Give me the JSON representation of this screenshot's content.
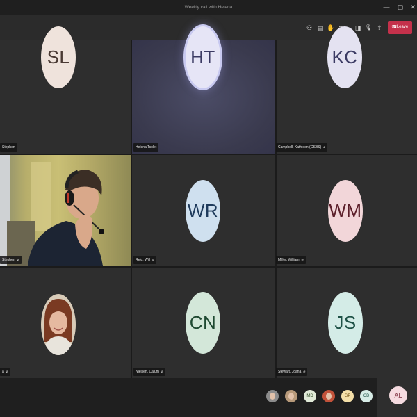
{
  "window": {
    "title": "Weekly call with Helena",
    "minimize_glyph": "—",
    "maximize_glyph": "▢",
    "close_glyph": "✕"
  },
  "toolbar": {
    "icons": {
      "participants": "⚇",
      "chat": "▤",
      "raise_hand": "✋",
      "more": "•••",
      "camera": "◨",
      "mic": "🎙",
      "share": "⇪"
    },
    "leave_label": "Leave",
    "leave_icon": "☎",
    "leave_color": "#c4314b"
  },
  "tiles": [
    {
      "initials": "SL",
      "name": "Stephen",
      "avatar_bg": "#efe3dc",
      "avatar_fg": "#4a3a34",
      "muted": false
    },
    {
      "initials": "HT",
      "name": "Helena Tsolet",
      "avatar_bg": "#e6e5f6",
      "avatar_fg": "#3b3a63",
      "muted": false,
      "speaking": true
    },
    {
      "initials": "KC",
      "name": "Campbell, Kathleen (GSBS)",
      "avatar_bg": "#e4e2f1",
      "avatar_fg": "#3b3a63",
      "muted": true
    },
    {
      "initials": "",
      "name": "Stephen",
      "video": true,
      "muted": true
    },
    {
      "initials": "WR",
      "name": "Reid, Will",
      "avatar_bg": "#cfe0ef",
      "avatar_fg": "#1f3b5c",
      "muted": true
    },
    {
      "initials": "WM",
      "name": "Miller, William",
      "avatar_bg": "#f2d6d9",
      "avatar_fg": "#5c1f2a",
      "muted": true
    },
    {
      "initials": "",
      "name": "a",
      "photo": true,
      "muted": true
    },
    {
      "initials": "CN",
      "name": "Nielsen, Calum",
      "avatar_bg": "#d3e7d9",
      "avatar_fg": "#1f4a32",
      "muted": true
    },
    {
      "initials": "JS",
      "name": "Stewart, Joana",
      "avatar_bg": "#d4ece7",
      "avatar_fg": "#1f5247",
      "muted": true
    }
  ],
  "mic_off_glyph": "🎙̸",
  "roster": [
    {
      "initials": "",
      "photo": true,
      "bg": "#8c8c8c"
    },
    {
      "initials": "",
      "photo": true,
      "bg": "#b89a7a"
    },
    {
      "initials": "MD",
      "bg": "#e1ead8",
      "fg": "#2c4a22"
    },
    {
      "initials": "",
      "photo": true,
      "bg": "#c2523a"
    },
    {
      "initials": "GP",
      "bg": "#f4dfa8",
      "fg": "#6b4a0c"
    },
    {
      "initials": "CB",
      "bg": "#d7ece6",
      "fg": "#1f5247"
    }
  ],
  "self": {
    "initials": "AL",
    "bg": "#f5dbe0",
    "fg": "#7a2a3a"
  }
}
